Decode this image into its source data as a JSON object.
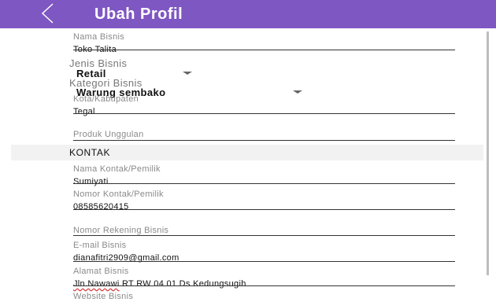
{
  "appbar": {
    "title": "Ubah Profil",
    "back_icon": "chevron-left-icon",
    "color": "#7e57c2"
  },
  "form": {
    "nama_bisnis": {
      "label": "Nama Bisnis",
      "value": "Toko Talita"
    },
    "jenis_bisnis": {
      "label": "Jenis Bisnis",
      "value": "Retail"
    },
    "kategori_bisnis": {
      "label": "Kategori Bisnis",
      "value": "Warung sembako"
    },
    "kota_kabupaten": {
      "label": "Kota/Kabupaten",
      "value": "Tegal"
    },
    "produk_unggulan": {
      "label": "Produk Unggulan",
      "value": ""
    },
    "kontak_section": "KONTAK",
    "nama_kontak": {
      "label": "Nama Kontak/Pemilik",
      "value": "Sumiyati"
    },
    "nomor_kontak": {
      "label": "Nomor Kontak/Pemilik",
      "value": "08585620415"
    },
    "nomor_rekening": {
      "label": "Nomor Rekening Bisnis",
      "value": ""
    },
    "email": {
      "label": "E-mail Bisnis",
      "value": "dianafitri2909@gmail.com"
    },
    "alamat": {
      "label": "Alamat Bisnis",
      "value_part1": "Jln.Nawawi",
      "value_part2": " RT RW 04 01  Ds Kedungsugih"
    },
    "website": {
      "label": "Website Bisnis",
      "value": ""
    }
  }
}
